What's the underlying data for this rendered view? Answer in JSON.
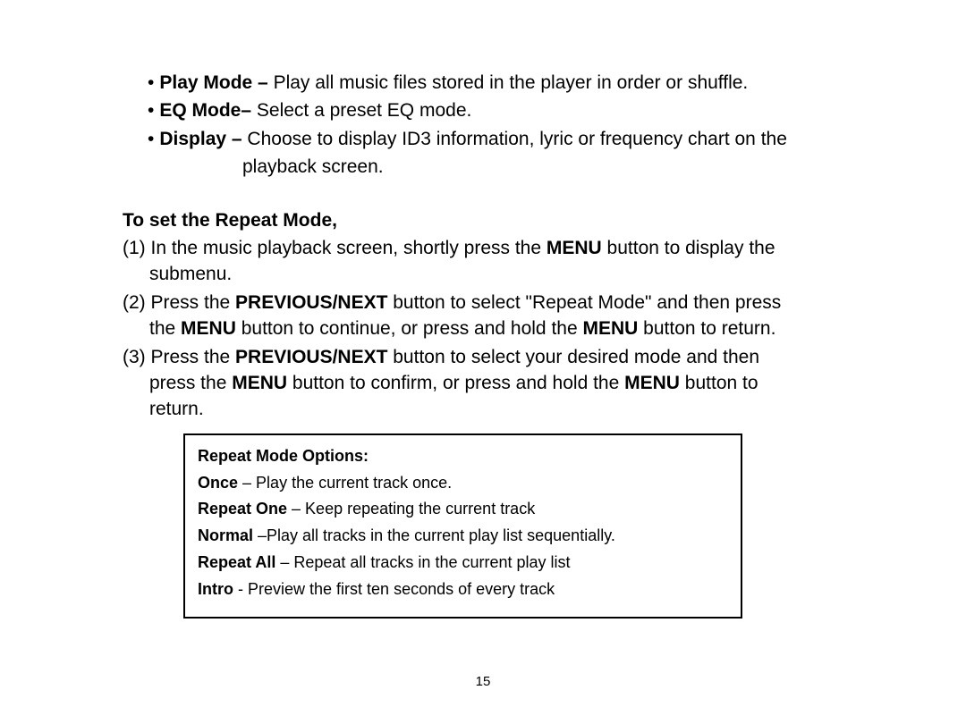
{
  "bullets": [
    {
      "label": "Play Mode – ",
      "desc": "Play all music files stored in the player in order or shuffle."
    },
    {
      "label": "EQ Mode– ",
      "desc": "Select a preset EQ mode."
    },
    {
      "label": "Display – ",
      "desc_line1": "Choose to display ID3 information, lyric or frequency chart on the",
      "desc_line2": "playback screen."
    }
  ],
  "heading": "To set the Repeat Mode,",
  "steps": [
    {
      "prefix": "(1) In the music playback screen, shortly press the ",
      "bold1": "MENU",
      "mid1": " button to display the",
      "cont": "submenu."
    },
    {
      "prefix": "(2) Press the ",
      "bold1": "PREVIOUS/NEXT",
      "mid1": " button to select \"Repeat Mode\" and then press",
      "cont_prefix": "the ",
      "cont_bold1": "MENU",
      "cont_mid1": " button to continue, or press and hold the ",
      "cont_bold2": "MENU",
      "cont_mid2": " button to return."
    },
    {
      "prefix": "(3) Press the ",
      "bold1": "PREVIOUS/NEXT",
      "mid1": " button to select your desired mode and then",
      "cont_prefix": "press the ",
      "cont_bold1": "MENU",
      "cont_mid1": " button to confirm, or press and hold the ",
      "cont_bold2": "MENU",
      "cont_mid2": " button to",
      "cont2": "return."
    }
  ],
  "options_heading": "Repeat Mode Options:",
  "options": [
    {
      "label": "Once",
      "sep": " – ",
      "desc": "Play the current track once."
    },
    {
      "label": "Repeat One",
      "sep": " – ",
      "desc": "Keep repeating the current track"
    },
    {
      "label": "Normal",
      "sep": " –",
      "desc": "Play all tracks in the current play list sequentially."
    },
    {
      "label": "Repeat All",
      "sep": " – ",
      "desc": "Repeat all tracks in the current play list"
    },
    {
      "label": "Intro",
      "sep": " - ",
      "desc": "Preview the first ten seconds of every track"
    }
  ],
  "page_number": "15"
}
